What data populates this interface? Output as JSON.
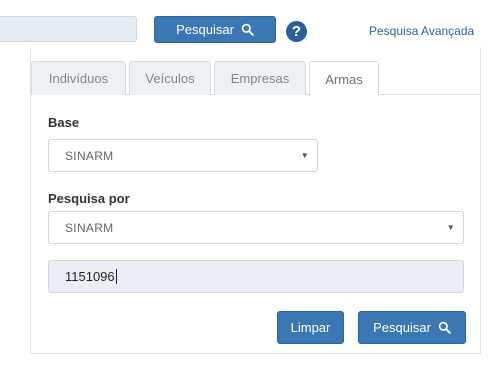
{
  "top_bar": {
    "search_button_label": "Pesquisar",
    "help_label": "?",
    "advanced_search_label": "Pesquisa Avançada"
  },
  "tabs": [
    {
      "label": "Indivíduos",
      "active": false
    },
    {
      "label": "Veículos",
      "active": false
    },
    {
      "label": "Empresas",
      "active": false
    },
    {
      "label": "Armas",
      "active": true
    }
  ],
  "form": {
    "base_label": "Base",
    "base_value": "SINARM",
    "search_by_label": "Pesquisa por",
    "search_by_value": "SINARM",
    "query_value": "1151096",
    "clear_button_label": "Limpar",
    "search_button_label": "Pesquisar"
  },
  "icons": {
    "search": "search-icon",
    "help": "question-circle-icon",
    "dropdown": "chevron-down-icon"
  },
  "colors": {
    "primary": "#3a77b3",
    "help": "#2c5f97",
    "link": "#2f6399",
    "input_background": "#e8eef3"
  }
}
